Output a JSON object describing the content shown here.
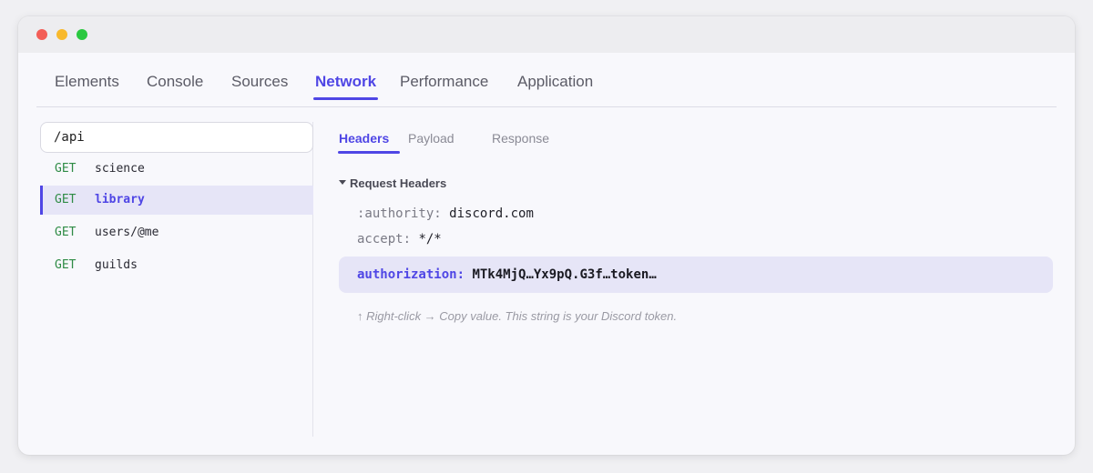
{
  "tabs": [
    "Elements",
    "Console",
    "Sources",
    "Network",
    "Performance",
    "Application"
  ],
  "active_tab": "Network",
  "filter": {
    "value": "/api"
  },
  "requests": [
    {
      "method": "GET",
      "name": "science"
    },
    {
      "method": "GET",
      "name": "library"
    },
    {
      "method": "GET",
      "name": "users/@me"
    },
    {
      "method": "GET",
      "name": "guilds"
    }
  ],
  "selected_request": "library",
  "subtabs": [
    "Headers",
    "Payload",
    "Response"
  ],
  "active_subtab": "Headers",
  "section": {
    "title": "Request Headers"
  },
  "headers": [
    {
      "key": ":authority:",
      "value": "discord.com"
    },
    {
      "key": "accept:",
      "value": "*/*"
    }
  ],
  "authorization": {
    "key": "authorization:",
    "value": "MTk4MjQ…Yx9pQ.G3f…token…"
  },
  "hint": "↑ Right-click → Copy value. This string is your Discord token.",
  "colors": {
    "accent": "#4f46e5",
    "method_get": "#2e8b45",
    "highlight": "#e6e5f7"
  }
}
